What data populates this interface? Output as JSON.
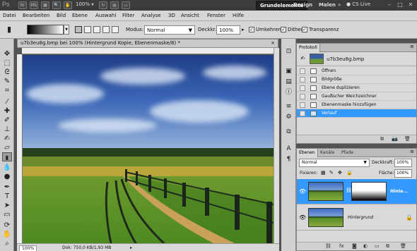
{
  "app": {
    "logo": "Ps",
    "icons": [
      "Br",
      "Mb"
    ],
    "zoom": "100%",
    "workspaces": [
      "Grundelemente",
      "Design",
      "Malen"
    ],
    "active_workspace": "Grundelemente",
    "more": "»",
    "cs_live": "CS Live",
    "window_controls": [
      "–",
      "□",
      "✕"
    ]
  },
  "menu": [
    "Datei",
    "Bearbeiten",
    "Bild",
    "Ebene",
    "Auswahl",
    "Filter",
    "Analyse",
    "3D",
    "Ansicht",
    "Fenster",
    "Hilfe"
  ],
  "options": {
    "mode_label": "Modus:",
    "mode_value": "Normal",
    "opacity_label": "Deckkr.:",
    "opacity_value": "100%",
    "reverse_label": "Umkehren",
    "dither_label": "Dither",
    "transparency_label": "Transparenz",
    "reverse_checked": true,
    "dither_checked": true,
    "transparency_checked": true
  },
  "document": {
    "tab_title": "u7b3eu8g.bmp bei 100% (Hintergrund Kopie, Ebenenmaske/8) *",
    "close": "×",
    "zoom": "100%",
    "doc_info": "Dok: 750,0 KB/1,93 MB"
  },
  "history": {
    "tab": "Protokoll",
    "snapshot_label": "u7b3eu8g.bmp",
    "items": [
      "Öffnen",
      "Bildgröße",
      "Ebene duplizieren",
      "Gaußscher Weichzeichner",
      "Ebenenmaske hinzufügen",
      "Verlauf"
    ],
    "selected_index": 5
  },
  "layers": {
    "tabs": [
      "Ebenen",
      "Kanäle",
      "Pfade"
    ],
    "blend_mode": "Normal",
    "opacity_label": "Deckkraft:",
    "opacity_value": "100%",
    "lock_label": "Fixieren:",
    "fill_label": "Fläche:",
    "fill_value": "100%",
    "items": [
      {
        "name": "Hinte...",
        "selected": true,
        "has_mask": true
      },
      {
        "name": "Hintergrund",
        "selected": false,
        "locked": true
      }
    ]
  },
  "colors": {
    "selection": "#3399ff",
    "appbar": "#3c3c3c",
    "panel": "#d9d9d9"
  }
}
